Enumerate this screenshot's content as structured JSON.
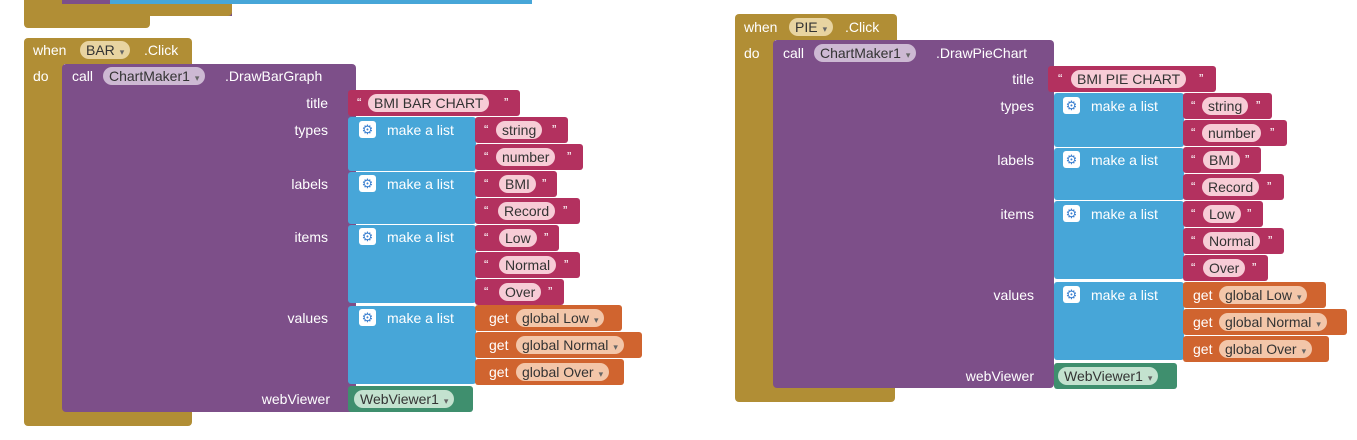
{
  "colors": {
    "event_block": "#b18e35",
    "procedure_block": "#7d4f89",
    "list_block": "#47a6d8",
    "text_block": "#b3315f",
    "variable_block": "#d0642f",
    "component_block": "#3f8f6e"
  },
  "icons": {
    "mutator": "gear-icon",
    "dropdown": "chevron-down-icon"
  },
  "bar": {
    "when": "when",
    "button": "BAR",
    "event": ".Click",
    "do": "do",
    "call": "call",
    "component": "ChartMaker1",
    "method": ".DrawBarGraph",
    "title_label": "title",
    "title_value": "BMI BAR CHART",
    "types_label": "types",
    "labels_label": "labels",
    "items_label": "items",
    "values_label": "values",
    "webviewer_label": "webViewer",
    "make_list": "make a list",
    "types": [
      "string",
      "number"
    ],
    "labels": [
      "BMI",
      "Record"
    ],
    "items": [
      "Low",
      "Normal",
      "Over"
    ],
    "get": "get",
    "values": [
      "global Low",
      "global Normal",
      "global Over"
    ],
    "webviewer": "WebViewer1"
  },
  "pie": {
    "when": "when",
    "button": "PIE",
    "event": ".Click",
    "do": "do",
    "call": "call",
    "component": "ChartMaker1",
    "method": ".DrawPieChart",
    "title_label": "title",
    "title_value": "BMI PIE CHART",
    "types_label": "types",
    "labels_label": "labels",
    "items_label": "items",
    "values_label": "values",
    "webviewer_label": "webViewer",
    "make_list": "make a list",
    "types": [
      "string",
      "number"
    ],
    "labels": [
      "BMI",
      "Record"
    ],
    "items": [
      "Low",
      "Normal",
      "Over"
    ],
    "get": "get",
    "values": [
      "global Low",
      "global Normal",
      "global Over"
    ],
    "webviewer": "WebViewer1"
  },
  "quote_open": "“",
  "quote_close": "”",
  "caret": "▾"
}
